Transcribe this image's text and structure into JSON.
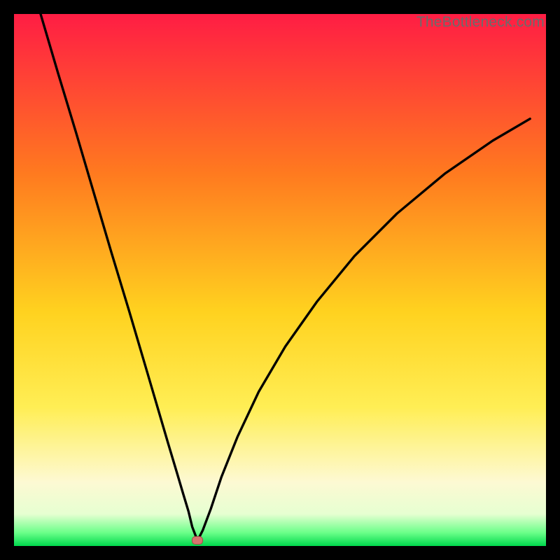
{
  "watermark": "TheBottleneck.com",
  "gradient_colors": {
    "top": "#ff1d44",
    "upper_mid": "#ff7a1f",
    "mid": "#ffd21f",
    "lower_mid": "#ffee55",
    "cream": "#fdf9d3",
    "pale": "#e6ffd1",
    "edge_green": "#6bff89",
    "bottom_green": "#00d84d"
  },
  "marker": {
    "x_frac": 0.345,
    "y_frac": 0.99,
    "fill": "#d6756f",
    "stroke": "#a54c47"
  },
  "chart_data": {
    "type": "line",
    "title": "",
    "xlabel": "",
    "ylabel": "",
    "x_range": [
      0,
      1
    ],
    "y_range": [
      0,
      1
    ],
    "annotations": [
      "TheBottleneck.com"
    ],
    "description": "V-shaped bottleneck curve on red-to-green vertical gradient. Curve descends from top-left to a minimum near x≈0.33, y≈0.99 (a small pink marker sits there), then rises concavely toward the upper right. Values below are normalized plot coordinates (0,0 = top-left of plot area).",
    "series": [
      {
        "name": "bottleneck-curve",
        "x": [
          0.05,
          0.083,
          0.117,
          0.15,
          0.183,
          0.217,
          0.25,
          0.27,
          0.29,
          0.305,
          0.318,
          0.328,
          0.335,
          0.345,
          0.355,
          0.37,
          0.39,
          0.42,
          0.46,
          0.51,
          0.57,
          0.64,
          0.72,
          0.81,
          0.9,
          0.97
        ],
        "y": [
          0.0,
          0.112,
          0.224,
          0.336,
          0.448,
          0.56,
          0.672,
          0.74,
          0.808,
          0.858,
          0.902,
          0.935,
          0.964,
          0.99,
          0.97,
          0.93,
          0.87,
          0.795,
          0.71,
          0.625,
          0.54,
          0.455,
          0.375,
          0.3,
          0.238,
          0.197
        ]
      }
    ],
    "marker_point": {
      "x": 0.345,
      "y": 0.99
    }
  }
}
